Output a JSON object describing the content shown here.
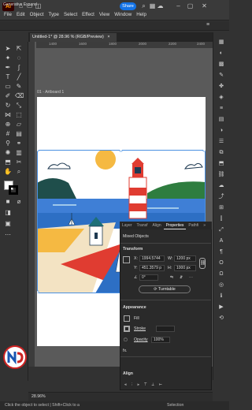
{
  "menubar": [
    "File",
    "Edit",
    "Object",
    "Type",
    "Select",
    "Effect",
    "View",
    "Window",
    "Help"
  ],
  "share_label": "Share",
  "context_label": "Generative Expand",
  "doc_tab": "Untitled-1* @ 28.96 % (RGB/Preview)",
  "artboard_label": "01 - Artboard 1",
  "ruler_ticks": [
    "1400",
    "1600",
    "1800",
    "2000",
    "2200",
    "2400"
  ],
  "panel": {
    "tabs": [
      "Layer",
      "Transf",
      "Align",
      "Properties",
      "Pathfi",
      "»"
    ],
    "active_tab": "Properties",
    "section_mixed": "Mixed Objects",
    "transform_label": "Transform",
    "x_label": "X:",
    "x_value": "1994.5744",
    "y_label": "Y:",
    "y_value": "451.3579 p",
    "w_label": "W:",
    "w_value": "1200 px",
    "h_label": "H:",
    "h_value": "1000 px",
    "angle_value": "0°",
    "turntable_label": "Turntable",
    "appearance_label": "Appearance",
    "fill_label": "Fill",
    "stroke_label": "Stroke",
    "opacity_label": "Opacity",
    "opacity_value": "100%",
    "fx_label": "fx.",
    "align_label": "Align"
  },
  "status": {
    "zoom": "28.96%",
    "hint": "Click the object to select | Shift+Click to a",
    "selection": "Selection"
  },
  "colors": {
    "accent": "#1473e6",
    "sky_blue": "#3f7fd6",
    "sea_blue": "#9ec7ea",
    "lighthouse_red": "#e03c31",
    "sun": "#f5b942",
    "hill_dark": "#1f4e4b",
    "hill_green": "#2e7d3f",
    "sand": "#f3e3c3",
    "house_teal": "#1d6f77"
  }
}
